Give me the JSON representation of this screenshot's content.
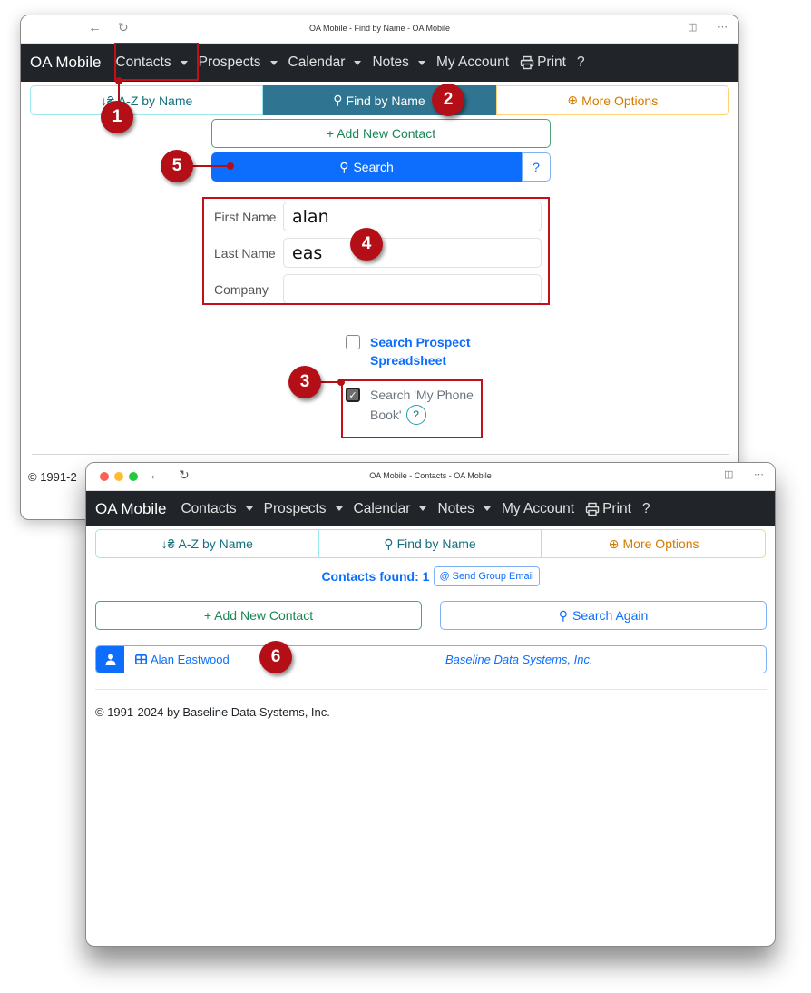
{
  "window1": {
    "title": "OA Mobile - Find by Name - OA Mobile",
    "navbar": {
      "brand": "OA Mobile",
      "items": [
        {
          "label": "Contacts",
          "dropdown": true
        },
        {
          "label": "Prospects",
          "dropdown": true
        },
        {
          "label": "Calendar",
          "dropdown": true
        },
        {
          "label": "Notes",
          "dropdown": true
        },
        {
          "label": "My Account",
          "dropdown": false
        },
        {
          "label": "Print",
          "icon": "printer-icon"
        },
        {
          "label": "?",
          "dropdown": false
        }
      ]
    },
    "tabs": [
      {
        "label": "A-Z by Name",
        "icon": "sort-alpha-icon"
      },
      {
        "label": "Find by Name",
        "icon": "search-icon",
        "active": true
      },
      {
        "label": "More Options",
        "icon": "zoom-plus-icon"
      }
    ],
    "add_contact_label": "+ Add New Contact",
    "search_label": "Search",
    "search_help": "?",
    "fields": [
      {
        "label": "First Name",
        "value": "alan"
      },
      {
        "label": "Last Name",
        "value": "eas"
      },
      {
        "label": "Company",
        "value": ""
      }
    ],
    "checkboxes": [
      {
        "label_line1": "Search Prospect",
        "label_line2": "Spreadsheet",
        "checked": false
      },
      {
        "label_line1": "Search 'My Phone",
        "label_line2": "Book'",
        "checked": true,
        "help": "?"
      }
    ],
    "footer": "© 1991-2"
  },
  "window2": {
    "title": "OA Mobile - Contacts - OA Mobile",
    "navbar": {
      "brand": "OA Mobile",
      "items": [
        {
          "label": "Contacts",
          "dropdown": true
        },
        {
          "label": "Prospects",
          "dropdown": true
        },
        {
          "label": "Calendar",
          "dropdown": true
        },
        {
          "label": "Notes",
          "dropdown": true
        },
        {
          "label": "My Account",
          "dropdown": false
        },
        {
          "label": "Print",
          "icon": "printer-icon"
        },
        {
          "label": "?",
          "dropdown": false
        }
      ]
    },
    "tabs": [
      {
        "label": "A-Z by Name",
        "icon": "sort-alpha-icon"
      },
      {
        "label": "Find by Name",
        "icon": "search-icon"
      },
      {
        "label": "More Options",
        "icon": "zoom-plus-icon"
      }
    ],
    "contacts_found_label": "Contacts found: 1",
    "send_group_email_label": "Send Group Email",
    "add_contact_label": "+ Add New Contact",
    "search_again_label": "Search Again",
    "results": [
      {
        "name": "Alan Eastwood",
        "company": "Baseline Data Systems, Inc."
      }
    ],
    "footer": "© 1991-2024 by Baseline Data Systems, Inc."
  },
  "callouts": [
    "1",
    "2",
    "3",
    "4",
    "5",
    "6"
  ],
  "colors": {
    "navbar_bg": "#212529",
    "primary": "#0d6efd",
    "active_tab": "#2f7591",
    "callout": "#b40f17",
    "success": "#198754",
    "warning": "#d37a00"
  }
}
